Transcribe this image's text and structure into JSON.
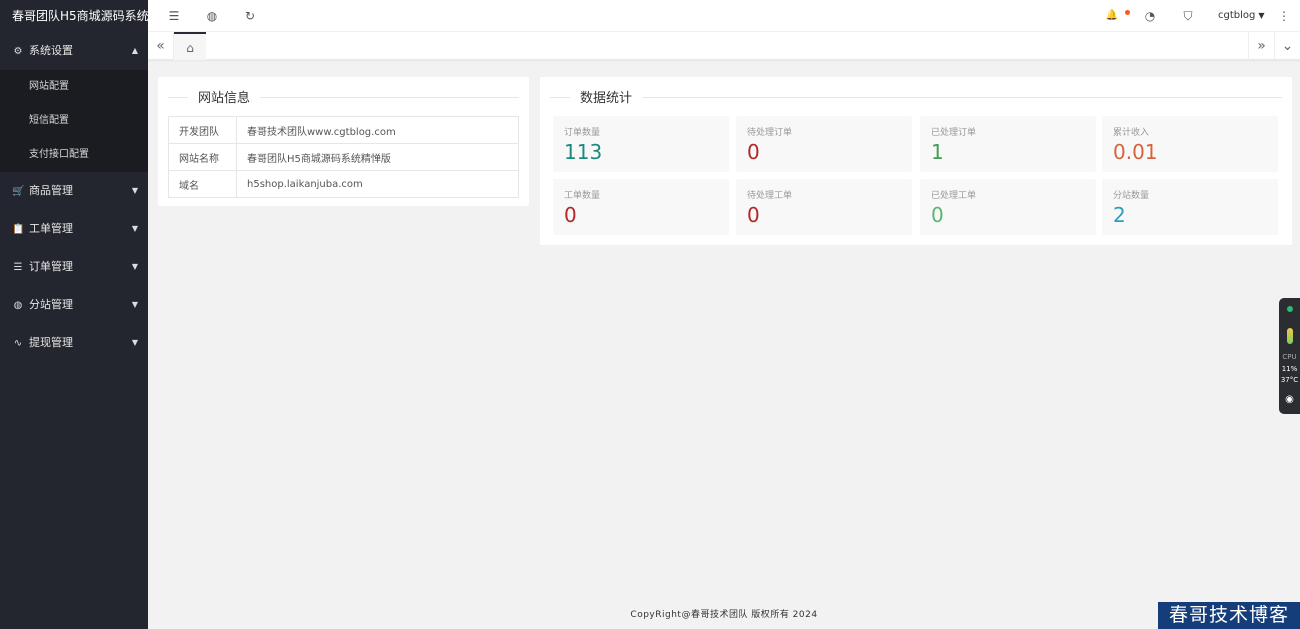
{
  "sidebar": {
    "logo": "春哥团队H5商城源码系统",
    "groups": [
      {
        "label": "系统设置",
        "icon": "gear-icon",
        "glyph": "⚙",
        "caret": "▲",
        "items": [
          "网站配置",
          "短信配置",
          "支付接口配置"
        ]
      },
      {
        "label": "商品管理",
        "icon": "cart-icon",
        "glyph": "🛒",
        "caret": "▼"
      },
      {
        "label": "工单管理",
        "icon": "ticket-icon",
        "glyph": "📋",
        "caret": "▼"
      },
      {
        "label": "订单管理",
        "icon": "layers-icon",
        "glyph": "☰",
        "caret": "▼"
      },
      {
        "label": "分站管理",
        "icon": "globe-icon",
        "glyph": "◍",
        "caret": "▼"
      },
      {
        "label": "提现管理",
        "icon": "pulse-icon",
        "glyph": "∿",
        "caret": "▼"
      }
    ]
  },
  "header": {
    "user": "cgtblog",
    "user_caret": "▼",
    "icons": {
      "menu": "☰",
      "globe": "◍",
      "refresh": "↻",
      "bell": "🔔",
      "theme": "◔",
      "tag": "⛉",
      "more": "⋮"
    }
  },
  "tabs": {
    "left": "«",
    "home": "⌂",
    "right": "»",
    "down": "⌄"
  },
  "info_card": {
    "title": "网站信息",
    "rows": [
      {
        "key": "开发团队",
        "value": "春哥技术团队www.cgtblog.com"
      },
      {
        "key": "网站名称",
        "value": "春哥团队H5商城源码系统精惮版"
      },
      {
        "key": "域名",
        "value": "h5shop.laikanjuba.com"
      }
    ]
  },
  "stats_card": {
    "title": "数据统计",
    "stats": [
      {
        "label": "订单数量",
        "value": "113",
        "color": "#1a8a7c"
      },
      {
        "label": "待处理订单",
        "value": "0",
        "color": "#b3262a"
      },
      {
        "label": "已处理订单",
        "value": "1",
        "color": "#3d9e52"
      },
      {
        "label": "累计收入",
        "value": "0.01",
        "color": "#d7623b"
      },
      {
        "label": "工单数量",
        "value": "0",
        "color": "#b3262a"
      },
      {
        "label": "待处理工单",
        "value": "0",
        "color": "#b3262a"
      },
      {
        "label": "已处理工单",
        "value": "0",
        "color": "#5bb574"
      },
      {
        "label": "分站数量",
        "value": "2",
        "color": "#2a9fbf"
      }
    ]
  },
  "footer": {
    "text": "CopyRight@春哥技术团队 版权所有 2024"
  },
  "widget": {
    "cpu_label": "CPU",
    "cpu": "11%",
    "temp": "37°C",
    "camera": "◉"
  },
  "watermark": "春哥技术博客"
}
